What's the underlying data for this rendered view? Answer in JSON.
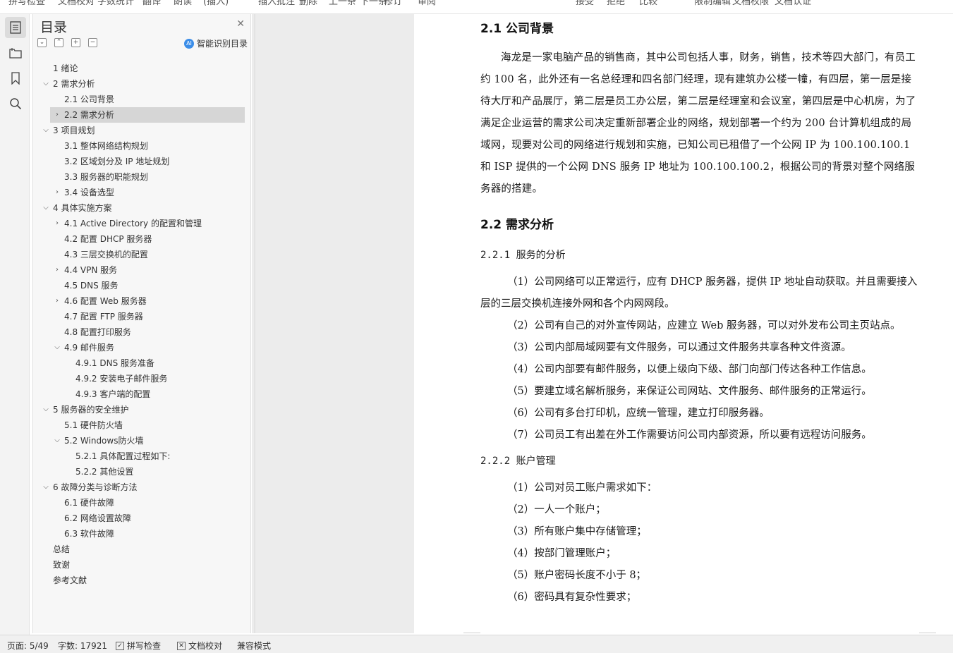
{
  "top_strip": [
    "拼写检查",
    "文档校对",
    "字数统计",
    "翻译",
    "朗读",
    "(插入)",
    "插入批注",
    "删除",
    "上一条",
    "下一条",
    "修订",
    "审阅",
    "接受",
    "拒绝",
    "比较",
    "限制编辑",
    "文档权限",
    "文档认证"
  ],
  "rail": {
    "icons": [
      "outline-icon",
      "nav-pane-icon",
      "bookmark-icon",
      "search-icon"
    ]
  },
  "toc": {
    "title": "目录",
    "smart_label": "智能识别目录",
    "ai_badge": "AI",
    "items": [
      {
        "label": "1  绪论",
        "level": 1,
        "chev": ""
      },
      {
        "label": "2  需求分析",
        "level": 1,
        "chev": "down"
      },
      {
        "label": "2.1 公司背景",
        "level": 2,
        "chev": ""
      },
      {
        "label": "2.2 需求分析",
        "level": 2,
        "chev": "right",
        "selected": true
      },
      {
        "label": "3  项目规划",
        "level": 1,
        "chev": "down"
      },
      {
        "label": "3.1 整体网络结构规划",
        "level": 2,
        "chev": ""
      },
      {
        "label": "3.2 区域划分及 IP 地址规划",
        "level": 2,
        "chev": ""
      },
      {
        "label": "3.3 服务器的职能规划",
        "level": 2,
        "chev": ""
      },
      {
        "label": "3.4  设备选型",
        "level": 2,
        "chev": "right"
      },
      {
        "label": "4  具体实施方案",
        "level": 1,
        "chev": "down"
      },
      {
        "label": "4.1 Active Directory 的配置和管理",
        "level": 2,
        "chev": "right"
      },
      {
        "label": "4.2  配置 DHCP 服务器",
        "level": 2,
        "chev": ""
      },
      {
        "label": "4.3  三层交换机的配置",
        "level": 2,
        "chev": ""
      },
      {
        "label": "4.4 VPN 服务",
        "level": 2,
        "chev": "right"
      },
      {
        "label": "4.5 DNS 服务",
        "level": 2,
        "chev": ""
      },
      {
        "label": "4.6  配置 Web 服务器",
        "level": 2,
        "chev": "right"
      },
      {
        "label": "4.7  配置 FTP 服务器",
        "level": 2,
        "chev": ""
      },
      {
        "label": "4.8 配置打印服务",
        "level": 2,
        "chev": ""
      },
      {
        "label": "4.9  邮件服务",
        "level": 2,
        "chev": "down"
      },
      {
        "label": "4.9.1 DNS 服务准备",
        "level": 3,
        "chev": ""
      },
      {
        "label": "4.9.2  安装电子邮件服务",
        "level": 3,
        "chev": ""
      },
      {
        "label": "4.9.3  客户端的配置",
        "level": 3,
        "chev": ""
      },
      {
        "label": "5  服务器的安全维护",
        "level": 1,
        "chev": "down"
      },
      {
        "label": "5.1  硬件防火墙",
        "level": 2,
        "chev": ""
      },
      {
        "label": "5.2 Windows防火墙",
        "level": 2,
        "chev": "down"
      },
      {
        "label": "5.2.1  具体配置过程如下:",
        "level": 3,
        "chev": ""
      },
      {
        "label": "5.2.2  其他设置",
        "level": 3,
        "chev": ""
      },
      {
        "label": "6  故障分类与诊断方法",
        "level": 1,
        "chev": "down"
      },
      {
        "label": "6.1 硬件故障",
        "level": 2,
        "chev": ""
      },
      {
        "label": "6.2 网络设置故障",
        "level": 2,
        "chev": ""
      },
      {
        "label": "6.3  软件故障",
        "level": 2,
        "chev": ""
      },
      {
        "label": "总结",
        "level": 1,
        "chev": ""
      },
      {
        "label": "致谢",
        "level": 1,
        "chev": ""
      },
      {
        "label": "参考文献",
        "level": 1,
        "chev": ""
      }
    ]
  },
  "doc": {
    "h_21": "2.1 公司背景",
    "p_21": "海龙是一家电脑产品的销售商，其中公司包括人事，财务，销售，技术等四大部门，有员工约 100 名，此外还有一名总经理和四名部门经理，现有建筑办公楼一幢，有四层，第一层是接待大厅和产品展厅，第二层是员工办公层，第二层是经理室和会议室，第四层是中心机房，为了满足企业运营的需求公司决定重新部署企业的网络，规划部署一个约为 200 台计算机组成的局域网，现要对公司的网络进行规划和实施，已知公司已租借了一个公网 IP 为 100.100.100.1 和 ISP 提供的一个公网 DNS 服务 IP 地址为 100.100.100.2，根据公司的背景对整个网络服务器的搭建。",
    "h_22": "2.2 需求分析",
    "h_221": "2.2.1  服务的分析",
    "list_221": [
      "（1）公司网络可以正常运行，应有 DHCP 服务器，提供 IP 地址自动获取。并且需要接入层的三层交换机连接外网和各个内网网段。",
      "（2）公司有自己的对外宣传网站，应建立 Web 服务器，可以对外发布公司主页站点。",
      "（3）公司内部局域网要有文件服务，可以通过文件服务共享各种文件资源。",
      "（4）公司内部要有邮件服务，以便上级向下级、部门向部门传达各种工作信息。",
      "（5）要建立域名解析服务，来保证公司网站、文件服务、邮件服务的正常运行。",
      "（6）公司有多台打印机，应统一管理，建立打印服务器。",
      "（7）公司员工有出差在外工作需要访问公司内部资源，所以要有远程访问服务。"
    ],
    "h_222": "2.2.2  账户管理",
    "list_222": [
      "（1）公司对员工账户需求如下：",
      "（2）一人一个账户；",
      "（3）所有账户集中存储管理；",
      "（4）按部门管理账户；",
      "（5）账户密码长度不小于 8；",
      "（6）密码具有复杂性要求；"
    ]
  },
  "status": {
    "page": "页面: 5/49",
    "words": "字数: 17921",
    "spell": "拼写检查",
    "proof": "文档校对",
    "compat": "兼容模式"
  }
}
